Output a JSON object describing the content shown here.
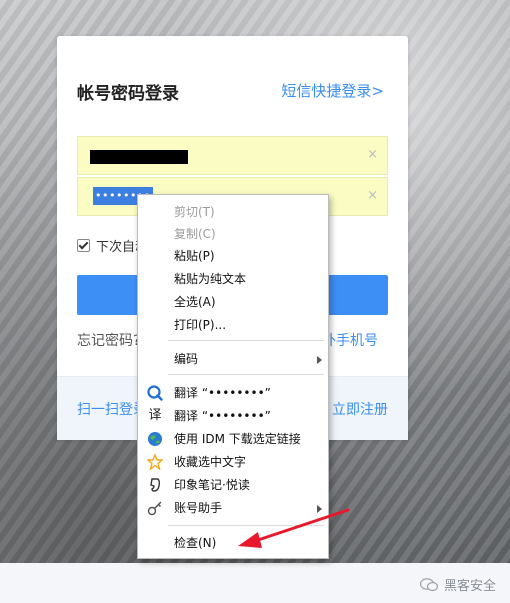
{
  "login": {
    "title": "帐号密码登录",
    "sms_link": "短信快捷登录>",
    "clear_glyph": "×",
    "password_masked": "••••••••",
    "remember_label": "下次自动",
    "forgot_label": "忘记密码?",
    "bind_phone_label": "外手机号",
    "scan_label": "扫一扫登录",
    "register_label": "立即注册"
  },
  "context_menu": {
    "items": [
      {
        "label": "剪切(T)",
        "enabled": false
      },
      {
        "label": "复制(C)",
        "enabled": false
      },
      {
        "label": "粘贴(P)",
        "enabled": true
      },
      {
        "label": "粘贴为纯文本",
        "enabled": true
      },
      {
        "label": "全选(A)",
        "enabled": true
      },
      {
        "label": "打印(P)...",
        "enabled": true
      },
      {
        "label": "编码",
        "enabled": true,
        "submenu": true
      },
      {
        "label": "翻译 “••••••••”",
        "enabled": true,
        "icon": "search-translate-icon"
      },
      {
        "label": "翻译 “••••••••”",
        "enabled": true,
        "icon": "translate-glyph-icon",
        "glyph": "译"
      },
      {
        "label": "使用 IDM 下载选定链接",
        "enabled": true,
        "icon": "idm-globe-icon"
      },
      {
        "label": "收藏选中文字",
        "enabled": true,
        "icon": "star-icon"
      },
      {
        "label": "印象笔记·悦读",
        "enabled": true,
        "icon": "evernote-icon"
      },
      {
        "label": "账号助手",
        "enabled": true,
        "icon": "key-icon",
        "submenu": true
      },
      {
        "label": "检查(N)",
        "enabled": true
      }
    ]
  },
  "watermark": {
    "text": "黑客安全"
  },
  "colors": {
    "accent": "#3e8ff5",
    "autofill": "#fafcc3",
    "annotation_arrow": "#e8192c"
  }
}
